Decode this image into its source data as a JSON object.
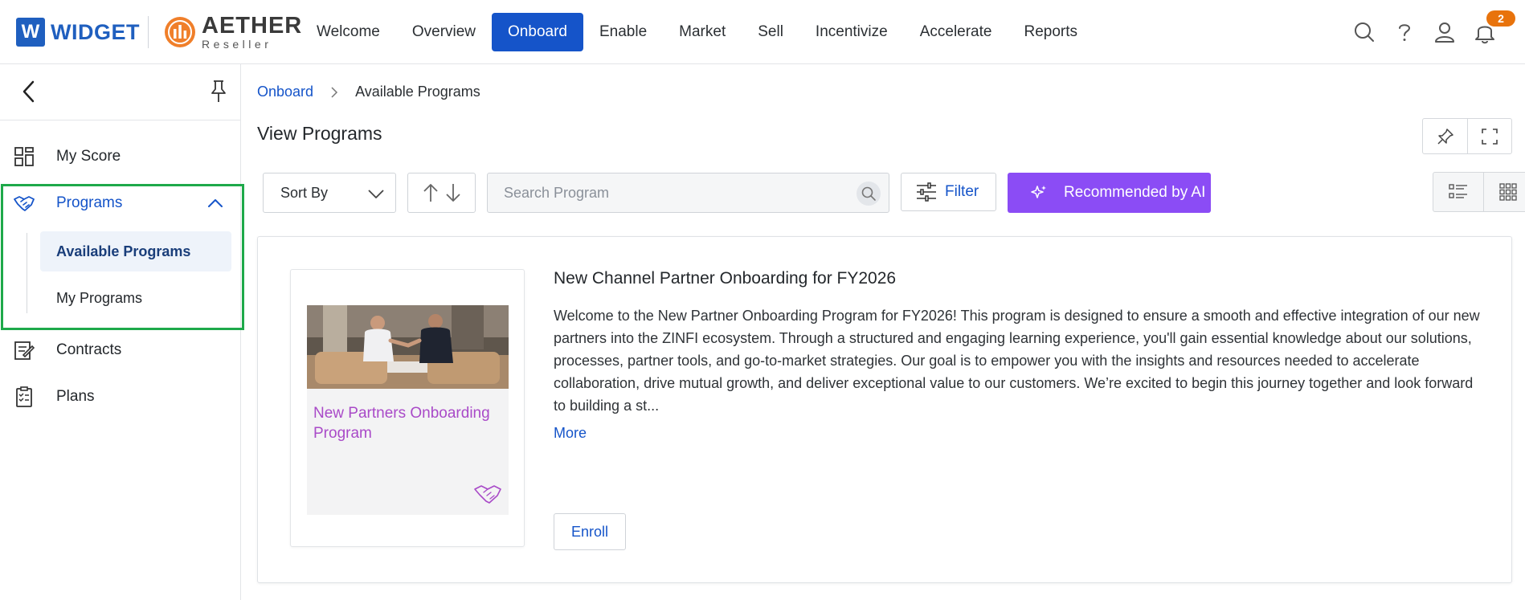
{
  "header": {
    "brand_left": {
      "letter": "W",
      "name": "WIDGET"
    },
    "brand_right": {
      "name": "AETHER",
      "sub": "Reseller"
    },
    "nav": [
      {
        "label": "Welcome",
        "active": false
      },
      {
        "label": "Overview",
        "active": false
      },
      {
        "label": "Onboard",
        "active": true
      },
      {
        "label": "Enable",
        "active": false
      },
      {
        "label": "Market",
        "active": false
      },
      {
        "label": "Sell",
        "active": false
      },
      {
        "label": "Incentivize",
        "active": false
      },
      {
        "label": "Accelerate",
        "active": false
      },
      {
        "label": "Reports",
        "active": false
      }
    ],
    "icons": [
      "search-icon",
      "help-icon",
      "user-icon",
      "bell-icon"
    ],
    "notification_count": "2",
    "accent_color": "#1554c9",
    "badge_color": "#e8730c"
  },
  "sidebar": {
    "items": [
      {
        "label": "My Score",
        "icon": "dashboard-icon"
      },
      {
        "label": "Programs",
        "icon": "handshake-icon",
        "expanded": true
      },
      {
        "label": "Contracts",
        "icon": "contract-icon"
      },
      {
        "label": "Plans",
        "icon": "checklist-icon"
      }
    ],
    "sub_items": [
      {
        "label": "Available Programs",
        "active": true
      },
      {
        "label": "My Programs",
        "active": false
      }
    ],
    "highlight_color": "#1ea94a"
  },
  "main": {
    "breadcrumb": {
      "parent": "Onboard",
      "current": "Available Programs"
    },
    "title": "View Programs",
    "toolbar": {
      "sort_label": "Sort By",
      "search_placeholder": "Search Program",
      "search_value": "",
      "filter_label": "Filter",
      "ai_label": "Recommended by AI",
      "ai_color": "#8b4cf5"
    },
    "program": {
      "title": "New Channel Partner Onboarding for FY2026",
      "image_caption": "New Partners Onboarding Program",
      "description": "Welcome to the New Partner Onboarding Program for FY2026! This program is designed to ensure a smooth and effective integration of our new partners into the ZINFI ecosystem. Through a structured and engaging learning experience, you'll gain essential knowledge about our solutions, processes, partner tools, and go-to-market strategies. Our goal is to empower you with the insights and resources needed to accelerate collaboration, drive mutual growth, and deliver exceptional value to our customers. We’re excited to begin this journey together and look forward to building a st...",
      "more_label": "More",
      "enroll_label": "Enroll"
    }
  }
}
